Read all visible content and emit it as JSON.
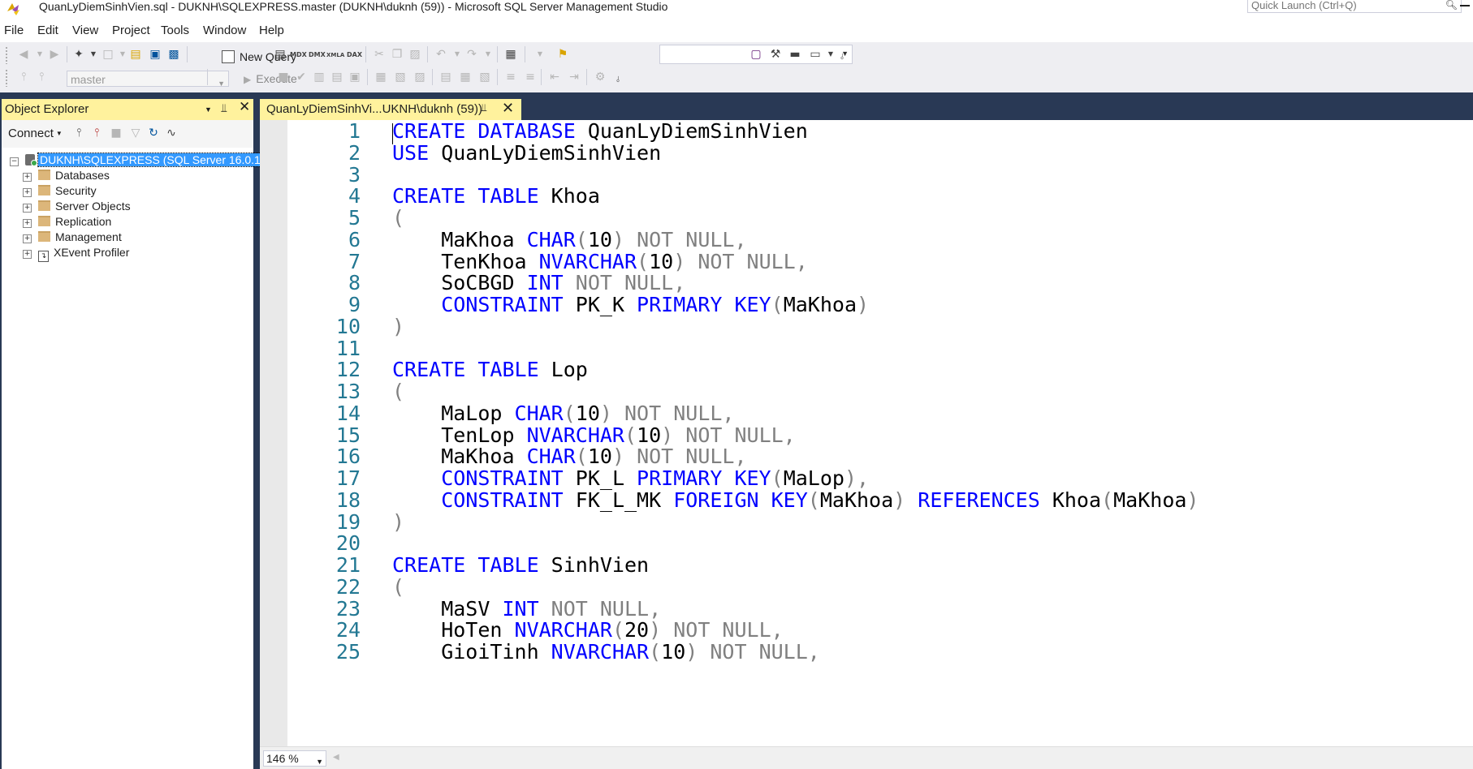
{
  "window": {
    "title": "QuanLyDiemSinhVien.sql - DUKNH\\SQLEXPRESS.master (DUKNH\\duknh (59)) - Microsoft SQL Server Management Studio",
    "quick_launch_placeholder": "Quick Launch (Ctrl+Q)"
  },
  "menu": [
    "File",
    "Edit",
    "View",
    "Project",
    "Tools",
    "Window",
    "Help"
  ],
  "toolbar": {
    "new_query_label": "New Query",
    "mdx_label": "MDX",
    "dmx_label": "DMX",
    "xmla_label": "XMLA",
    "dax_label": "DAX",
    "database_value": "master",
    "execute_label": "Execute"
  },
  "object_explorer": {
    "title": "Object Explorer",
    "connect_label": "Connect",
    "server": "DUKNH\\SQLEXPRESS (SQL Server 16.0.1",
    "nodes": [
      "Databases",
      "Security",
      "Server Objects",
      "Replication",
      "Management",
      "XEvent Profiler"
    ]
  },
  "editor": {
    "tab_title": "QuanLyDiemSinhVi...UKNH\\duknh (59))",
    "zoom": "146 %",
    "lines": [
      {
        "n": "1",
        "tokens": [
          [
            "kw",
            "CREATE DATABASE"
          ],
          [
            "id",
            " QuanLyDiemSinhVien"
          ]
        ]
      },
      {
        "n": "2",
        "tokens": [
          [
            "kw",
            "USE"
          ],
          [
            "id",
            " QuanLyDiemSinhVien"
          ]
        ]
      },
      {
        "n": "3",
        "tokens": []
      },
      {
        "n": "4",
        "tokens": [
          [
            "kw",
            "CREATE TABLE"
          ],
          [
            "id",
            " Khoa"
          ]
        ]
      },
      {
        "n": "5",
        "tokens": [
          [
            "gr",
            "("
          ]
        ]
      },
      {
        "n": "6",
        "tokens": [
          [
            "id",
            "    MaKhoa "
          ],
          [
            "kw",
            "CHAR"
          ],
          [
            "gr",
            "("
          ],
          [
            "id",
            "10"
          ],
          [
            "gr",
            ") NOT NULL,"
          ]
        ]
      },
      {
        "n": "7",
        "tokens": [
          [
            "id",
            "    TenKhoa "
          ],
          [
            "kw",
            "NVARCHAR"
          ],
          [
            "gr",
            "("
          ],
          [
            "id",
            "10"
          ],
          [
            "gr",
            ") NOT NULL,"
          ]
        ]
      },
      {
        "n": "8",
        "tokens": [
          [
            "id",
            "    SoCBGD "
          ],
          [
            "kw",
            "INT"
          ],
          [
            "gr",
            " NOT NULL,"
          ]
        ]
      },
      {
        "n": "9",
        "tokens": [
          [
            "id",
            "    "
          ],
          [
            "kw",
            "CONSTRAINT"
          ],
          [
            "id",
            " PK_K "
          ],
          [
            "kw",
            "PRIMARY KEY"
          ],
          [
            "gr",
            "("
          ],
          [
            "id",
            "MaKhoa"
          ],
          [
            "gr",
            ")"
          ]
        ]
      },
      {
        "n": "10",
        "tokens": [
          [
            "gr",
            ")"
          ]
        ]
      },
      {
        "n": "11",
        "tokens": []
      },
      {
        "n": "12",
        "tokens": [
          [
            "kw",
            "CREATE TABLE"
          ],
          [
            "id",
            " Lop"
          ]
        ]
      },
      {
        "n": "13",
        "tokens": [
          [
            "gr",
            "("
          ]
        ]
      },
      {
        "n": "14",
        "tokens": [
          [
            "id",
            "    MaLop "
          ],
          [
            "kw",
            "CHAR"
          ],
          [
            "gr",
            "("
          ],
          [
            "id",
            "10"
          ],
          [
            "gr",
            ") NOT NULL,"
          ]
        ]
      },
      {
        "n": "15",
        "tokens": [
          [
            "id",
            "    TenLop "
          ],
          [
            "kw",
            "NVARCHAR"
          ],
          [
            "gr",
            "("
          ],
          [
            "id",
            "10"
          ],
          [
            "gr",
            ") NOT NULL,"
          ]
        ]
      },
      {
        "n": "16",
        "tokens": [
          [
            "id",
            "    MaKhoa "
          ],
          [
            "kw",
            "CHAR"
          ],
          [
            "gr",
            "("
          ],
          [
            "id",
            "10"
          ],
          [
            "gr",
            ") NOT NULL,"
          ]
        ]
      },
      {
        "n": "17",
        "tokens": [
          [
            "id",
            "    "
          ],
          [
            "kw",
            "CONSTRAINT"
          ],
          [
            "id",
            " PK_L "
          ],
          [
            "kw",
            "PRIMARY KEY"
          ],
          [
            "gr",
            "("
          ],
          [
            "id",
            "MaLop"
          ],
          [
            "gr",
            "),"
          ]
        ]
      },
      {
        "n": "18",
        "tokens": [
          [
            "id",
            "    "
          ],
          [
            "kw",
            "CONSTRAINT"
          ],
          [
            "id",
            " FK_L_MK "
          ],
          [
            "kw",
            "FOREIGN KEY"
          ],
          [
            "gr",
            "("
          ],
          [
            "id",
            "MaKhoa"
          ],
          [
            "gr",
            ") "
          ],
          [
            "kw",
            "REFERENCES"
          ],
          [
            "id",
            " Khoa"
          ],
          [
            "gr",
            "("
          ],
          [
            "id",
            "MaKhoa"
          ],
          [
            "gr",
            ")"
          ]
        ]
      },
      {
        "n": "19",
        "tokens": [
          [
            "gr",
            ")"
          ]
        ]
      },
      {
        "n": "20",
        "tokens": []
      },
      {
        "n": "21",
        "tokens": [
          [
            "kw",
            "CREATE TABLE"
          ],
          [
            "id",
            " SinhVien"
          ]
        ]
      },
      {
        "n": "22",
        "tokens": [
          [
            "gr",
            "("
          ]
        ]
      },
      {
        "n": "23",
        "tokens": [
          [
            "id",
            "    MaSV "
          ],
          [
            "kw",
            "INT"
          ],
          [
            "gr",
            " NOT NULL,"
          ]
        ]
      },
      {
        "n": "24",
        "tokens": [
          [
            "id",
            "    HoTen "
          ],
          [
            "kw",
            "NVARCHAR"
          ],
          [
            "gr",
            "("
          ],
          [
            "id",
            "20"
          ],
          [
            "gr",
            ") NOT NULL,"
          ]
        ]
      },
      {
        "n": "25",
        "tokens": [
          [
            "id",
            "    GioiTinh "
          ],
          [
            "kw",
            "NVARCHAR"
          ],
          [
            "gr",
            "("
          ],
          [
            "id",
            "10"
          ],
          [
            "gr",
            ") NOT NULL,"
          ]
        ]
      }
    ]
  },
  "colors": {
    "keyword": "#0000ff",
    "operator": "#808080",
    "line_number": "#237893",
    "frame": "#293955",
    "active_tab": "#fff29d",
    "selection": "#3399ff"
  }
}
